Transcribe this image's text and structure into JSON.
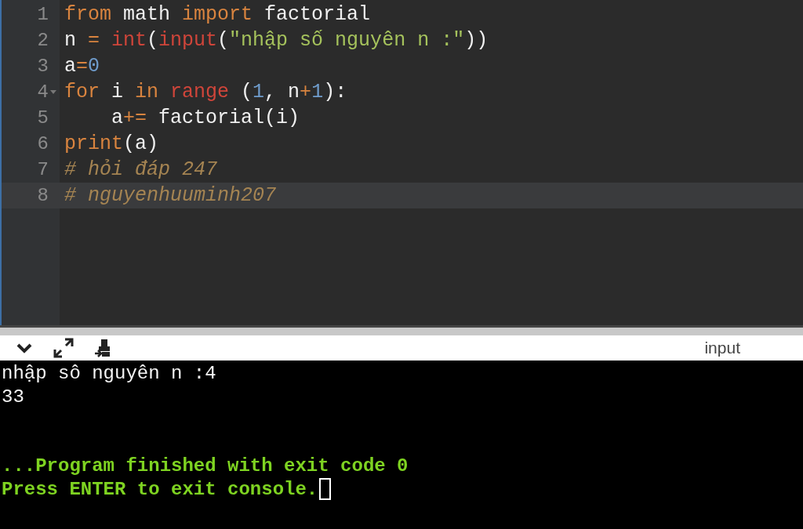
{
  "editor": {
    "lines": [
      {
        "number": "1",
        "foldable": false,
        "active": false,
        "tokens": [
          {
            "kind": "keyword",
            "text": "from"
          },
          {
            "kind": "plain",
            "text": " math "
          },
          {
            "kind": "keyword",
            "text": "import"
          },
          {
            "kind": "plain",
            "text": " factorial"
          }
        ]
      },
      {
        "number": "2",
        "foldable": false,
        "active": false,
        "tokens": [
          {
            "kind": "plain",
            "text": "n "
          },
          {
            "kind": "operator",
            "text": "= "
          },
          {
            "kind": "builtin",
            "text": "int"
          },
          {
            "kind": "plain",
            "text": "("
          },
          {
            "kind": "builtin",
            "text": "input"
          },
          {
            "kind": "plain",
            "text": "("
          },
          {
            "kind": "string",
            "text": "\"nhập số nguyên n :\""
          },
          {
            "kind": "plain",
            "text": "))"
          }
        ]
      },
      {
        "number": "3",
        "foldable": false,
        "active": false,
        "tokens": [
          {
            "kind": "plain",
            "text": "a"
          },
          {
            "kind": "operator",
            "text": "="
          },
          {
            "kind": "number",
            "text": "0"
          }
        ]
      },
      {
        "number": "4",
        "foldable": true,
        "active": false,
        "tokens": [
          {
            "kind": "keyword",
            "text": "for"
          },
          {
            "kind": "plain",
            "text": " i "
          },
          {
            "kind": "keyword",
            "text": "in "
          },
          {
            "kind": "builtin",
            "text": "range"
          },
          {
            "kind": "plain",
            "text": " ("
          },
          {
            "kind": "number",
            "text": "1"
          },
          {
            "kind": "plain",
            "text": ", n"
          },
          {
            "kind": "operator",
            "text": "+"
          },
          {
            "kind": "number",
            "text": "1"
          },
          {
            "kind": "plain",
            "text": "):"
          }
        ]
      },
      {
        "number": "5",
        "foldable": false,
        "active": false,
        "tokens": [
          {
            "kind": "plain",
            "text": "    a"
          },
          {
            "kind": "operator",
            "text": "+="
          },
          {
            "kind": "plain",
            "text": " factorial(i)"
          }
        ]
      },
      {
        "number": "6",
        "foldable": false,
        "active": false,
        "tokens": [
          {
            "kind": "keyword",
            "text": "print"
          },
          {
            "kind": "plain",
            "text": "(a)"
          }
        ]
      },
      {
        "number": "7",
        "foldable": false,
        "active": false,
        "tokens": [
          {
            "kind": "comment",
            "text": "# hỏi đáp 247"
          }
        ]
      },
      {
        "number": "8",
        "foldable": false,
        "active": true,
        "tokens": [
          {
            "kind": "comment",
            "text": "# nguyenhuuminh207"
          }
        ]
      }
    ]
  },
  "console": {
    "label": "input",
    "lines": [
      {
        "kind": "output",
        "text": "nhập sô nguyên n :4"
      },
      {
        "kind": "output",
        "text": "33"
      },
      {
        "kind": "blank"
      },
      {
        "kind": "blank"
      },
      {
        "kind": "status",
        "text": "...Program finished with exit code 0"
      },
      {
        "kind": "status",
        "text": "Press ENTER to exit console.",
        "cursor": true
      }
    ]
  }
}
